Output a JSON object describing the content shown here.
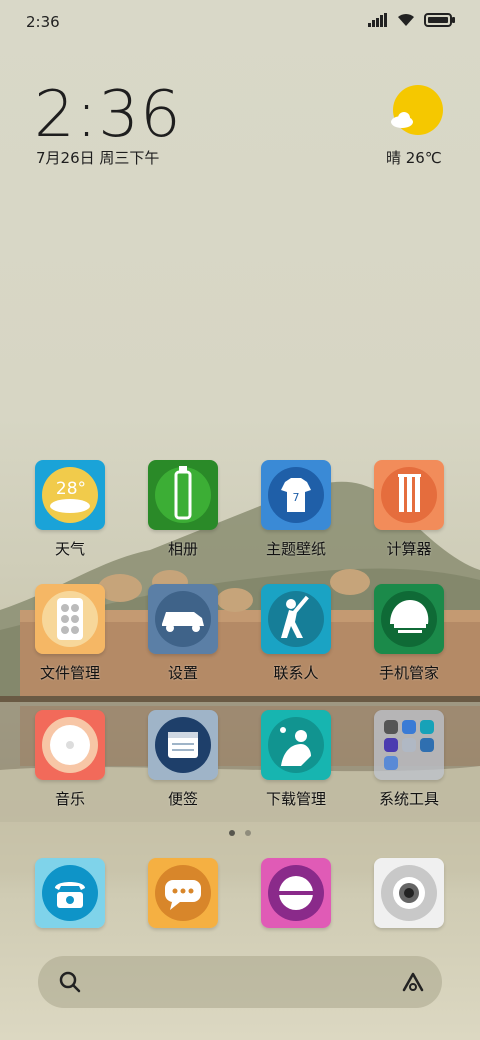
{
  "status_bar": {
    "time": "2:36"
  },
  "clock_widget": {
    "time": "2:36",
    "date": "7月26日 周三下午"
  },
  "weather_widget": {
    "text": "晴 26℃"
  },
  "apps": [
    {
      "label": "天气",
      "icon": "weather-icon",
      "badge": "28°"
    },
    {
      "label": "相册",
      "icon": "cricket-bat-icon"
    },
    {
      "label": "主题壁纸",
      "icon": "jersey-icon",
      "badge": "7"
    },
    {
      "label": "计算器",
      "icon": "stumps-icon"
    },
    {
      "label": "文件管理",
      "icon": "pills-icon"
    },
    {
      "label": "设置",
      "icon": "car-icon"
    },
    {
      "label": "联系人",
      "icon": "batsman-icon"
    },
    {
      "label": "手机管家",
      "icon": "helmet-icon"
    },
    {
      "label": "音乐",
      "icon": "disc-icon"
    },
    {
      "label": "便签",
      "icon": "notes-icon"
    },
    {
      "label": "下载管理",
      "icon": "catch-icon"
    },
    {
      "label": "系统工具",
      "icon": "folder-icon"
    }
  ],
  "dock": [
    {
      "name": "phone",
      "icon": "telephone-icon"
    },
    {
      "name": "messages",
      "icon": "chat-bubble-icon"
    },
    {
      "name": "browser",
      "icon": "cricket-ball-icon"
    },
    {
      "name": "camera",
      "icon": "camera-icon"
    }
  ],
  "page_indicator": {
    "pages": 2,
    "current": 1
  },
  "colors": {
    "accent_weather": "#f5c800",
    "text": "#1e1e1e"
  }
}
